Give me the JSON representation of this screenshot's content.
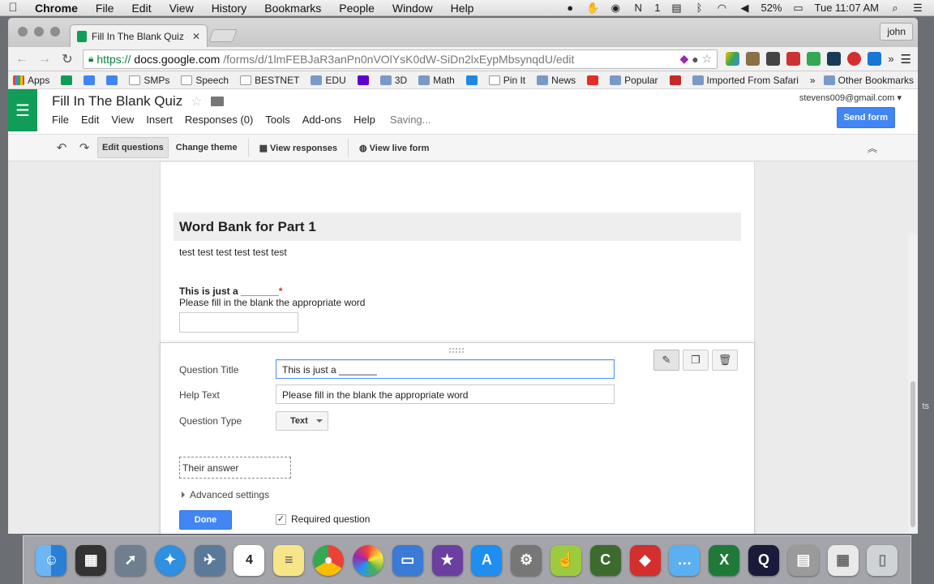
{
  "mac_menubar": {
    "apple": "",
    "items": [
      "Chrome",
      "File",
      "Edit",
      "View",
      "History",
      "Bookmarks",
      "People",
      "Window",
      "Help"
    ],
    "status": {
      "battery": "52%",
      "clock": "Tue 11:07 AM",
      "notification_count": "1"
    }
  },
  "browser": {
    "tab_title": "Fill In The Blank Quiz - Goo",
    "profile": "john",
    "url": {
      "scheme": "https://",
      "host": "docs.google.com",
      "path": "/forms/d/1lmFEBJaR3anPn0nVOlYsK0dW-SiDn2lxEypMbsynqdU/edit"
    },
    "bookmarks": [
      {
        "label": "Apps",
        "icon": "apps-grid-icon"
      },
      {
        "label": "",
        "icon": "sheets-icon"
      },
      {
        "label": "",
        "icon": "docs-icon"
      },
      {
        "label": "",
        "icon": "google-icon"
      },
      {
        "label": "SMPs",
        "icon": "page-icon"
      },
      {
        "label": "Speech",
        "icon": "page-icon"
      },
      {
        "label": "BESTNET",
        "icon": "page-icon"
      },
      {
        "label": "EDU",
        "icon": "folder-icon"
      },
      {
        "label": "",
        "icon": "yahoo-icon"
      },
      {
        "label": "3D",
        "icon": "folder-icon"
      },
      {
        "label": "Math",
        "icon": "folder-icon"
      },
      {
        "label": "",
        "icon": "bookmark-icon"
      },
      {
        "label": "Pin It",
        "icon": "page-icon"
      },
      {
        "label": "News",
        "icon": "folder-icon"
      },
      {
        "label": "",
        "icon": "youtube-icon"
      },
      {
        "label": "Popular",
        "icon": "folder-icon"
      },
      {
        "label": "",
        "icon": "red-icon"
      },
      {
        "label": "Imported From Safari",
        "icon": "folder-icon"
      }
    ],
    "bookmarks_overflow": "»",
    "other_bookmarks": "Other Bookmarks"
  },
  "app": {
    "title": "Fill In The Blank Quiz",
    "menu": [
      "File",
      "Edit",
      "View",
      "Insert",
      "Responses (0)",
      "Tools",
      "Add-ons",
      "Help"
    ],
    "saving_status": "Saving...",
    "account": "stevens009@gmail.com",
    "send_form": "Send form",
    "toolbar": {
      "edit_questions": "Edit questions",
      "change_theme": "Change theme",
      "view_responses": "View responses",
      "view_live_form": "View live form"
    }
  },
  "form": {
    "section_title": "Word Bank for Part 1",
    "section_description": "test test test test test test",
    "question_title": "This is just a _______",
    "question_required_mark": "*",
    "question_help": "Please fill in the blank the appropriate word"
  },
  "editor": {
    "labels": {
      "question_title": "Question Title",
      "help_text": "Help Text",
      "question_type": "Question Type"
    },
    "question_title_value": "This is just a _______",
    "help_text_value": "Please fill in the blank the appropriate word",
    "question_type_value": "Text",
    "answer_preview": "Their answer",
    "advanced_settings": "Advanced settings",
    "done": "Done",
    "required_label": "Required question",
    "required_checked": "✓"
  },
  "desktop_text": "ts",
  "colors": {
    "forms_green": "#0f9d58",
    "primary_blue": "#4285f4",
    "required_red": "#d93025"
  }
}
